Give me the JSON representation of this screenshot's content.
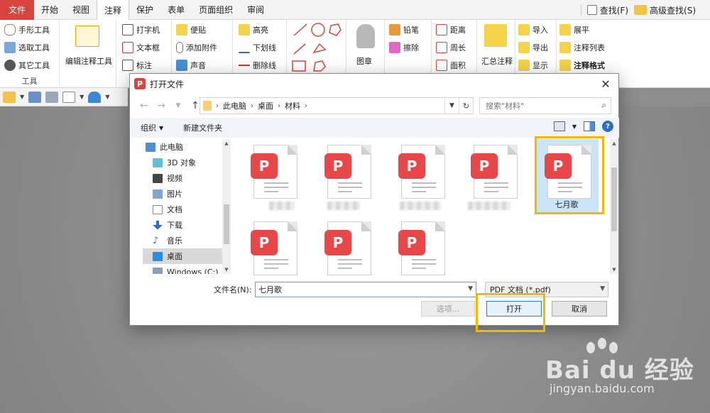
{
  "menubar": {
    "file": "文件",
    "tabs": [
      "开始",
      "视图",
      "注释",
      "保护",
      "表单",
      "页面组织",
      "审阅"
    ],
    "active_tab": "注释",
    "find": "查找(F)",
    "advanced_find": "高级查找(S)"
  },
  "ribbon": {
    "tools": {
      "hand": "手形工具",
      "select": "选取工具",
      "other": "其它工具",
      "label": "工具"
    },
    "edit_annot": "编辑注释工具",
    "text_tools": [
      "打字机",
      "文本框",
      "标注"
    ],
    "note_tools": [
      "便贴",
      "添加附件",
      "声音"
    ],
    "markup": [
      "高亮",
      "下划线",
      "删除线"
    ],
    "stamp": "图章",
    "pencil": [
      "铅笔",
      "擦除"
    ],
    "measure": [
      "距离",
      "周长",
      "面积"
    ],
    "summary": "汇总注释",
    "io": [
      "导入",
      "导出",
      "显示"
    ],
    "list": [
      "展平",
      "注释列表",
      "注释格式"
    ]
  },
  "dialog": {
    "title": "打开文件",
    "path": [
      "此电脑",
      "桌面",
      "材料"
    ],
    "search_placeholder": "搜索\"材料\"",
    "organize": "组织",
    "new_folder": "新建文件夹",
    "tree": [
      "此电脑",
      "3D 对象",
      "视频",
      "图片",
      "文档",
      "下载",
      "音乐",
      "桌面",
      "Windows (C:)"
    ],
    "tree_selected": "桌面",
    "files": [
      {
        "name": "",
        "selected": false
      },
      {
        "name": "",
        "selected": false
      },
      {
        "name": "",
        "selected": false
      },
      {
        "name": "",
        "selected": false
      },
      {
        "name": "七月歌",
        "selected": true
      },
      {
        "name": "",
        "selected": false
      },
      {
        "name": "",
        "selected": false
      },
      {
        "name": "",
        "selected": false
      }
    ],
    "filename_label": "文件名(N):",
    "filename_value": "七月歌",
    "filetype": "PDF 文档 (*.pdf)",
    "options": "选项...",
    "open": "打开",
    "cancel": "取消"
  },
  "watermark": {
    "brand": "Bai du 经验",
    "url": "jingyan.baidu.com"
  },
  "colors": {
    "accent": "#d9453d",
    "highlight": "#f5b800",
    "pdf": "#e8474a"
  }
}
